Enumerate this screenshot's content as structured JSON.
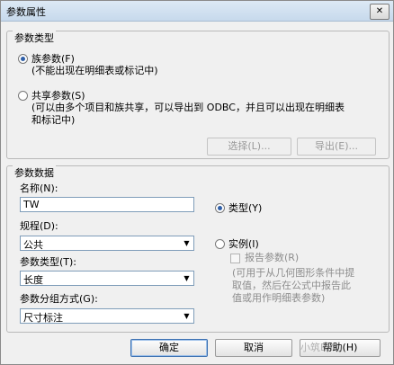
{
  "window": {
    "title": "参数属性",
    "close_glyph": "✕"
  },
  "param_type": {
    "legend": "参数类型",
    "family": {
      "label": "族参数(F)",
      "desc": "(不能出现在明细表或标记中)",
      "selected": true
    },
    "shared": {
      "label": "共享参数(S)",
      "desc_line1": "(可以由多个项目和族共享，可以导出到 ODBC，并且可以出现在明细表",
      "desc_line2": "和标记中)",
      "selected": false
    },
    "select_button": "选择(L)...",
    "export_button": "导出(E)..."
  },
  "param_data": {
    "legend": "参数数据",
    "name_label": "名称(N):",
    "name_value": "TW",
    "discipline_label": "规程(D):",
    "discipline_value": "公共",
    "type_label": "参数类型(T):",
    "type_value": "长度",
    "group_label": "参数分组方式(G):",
    "group_value": "尺寸标注",
    "kind_type": {
      "label": "类型(Y)",
      "selected": true
    },
    "kind_instance": {
      "label": "实例(I)",
      "selected": false
    },
    "report_param": "报告参数(R)",
    "report_desc_line1": "(可用于从几何图形条件中提",
    "report_desc_line2": "取值，然后在公式中报告此",
    "report_desc_line3": "值或用作明细表参数)"
  },
  "footer": {
    "ok": "确定",
    "cancel": "取消",
    "help": "帮助(H)"
  },
  "watermark": "小筑BIM"
}
